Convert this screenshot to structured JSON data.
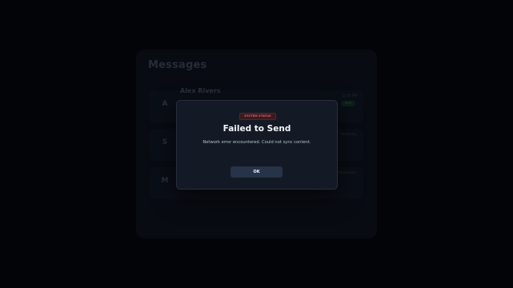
{
  "background": {
    "title": "Messages",
    "messages": [
      {
        "avatar": "A",
        "name": "Alex Rivers",
        "time": "12:45 PM",
        "badge": "NEW"
      },
      {
        "avatar": "S",
        "name": "",
        "time": "Yesterday",
        "badge": ""
      },
      {
        "avatar": "M",
        "name": "",
        "time": "Wednesday",
        "badge": ""
      }
    ]
  },
  "modal": {
    "status_label": "SYSTEM STATUS",
    "title": "Failed to Send",
    "message": "Network error encountered. Could not sync content.",
    "ok_label": "OK"
  },
  "colors": {
    "backdrop": "#030407",
    "modal_bg": "#141a25",
    "error": "#e2656c",
    "button_bg": "#263348"
  }
}
